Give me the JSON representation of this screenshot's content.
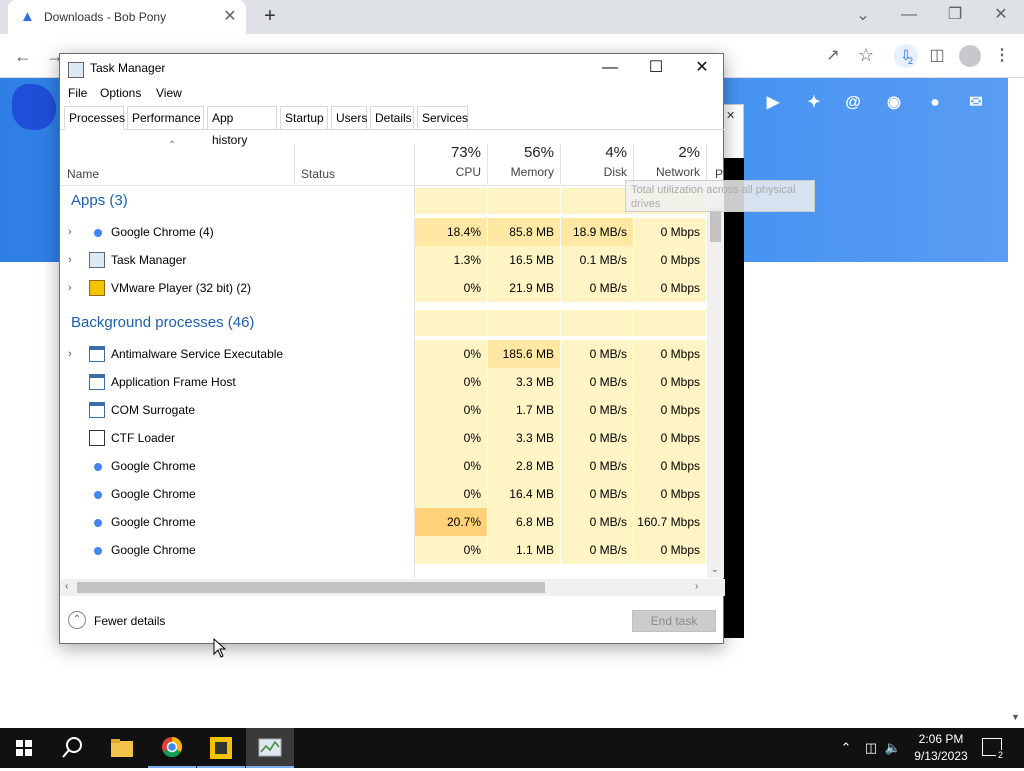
{
  "browser": {
    "tab_title": "Downloads - Bob Pony",
    "icons": [
      "chrome-favicon",
      "close-icon",
      "new-tab-icon",
      "back-icon",
      "forward-icon",
      "reload-icon",
      "share-icon",
      "star-icon",
      "download-icon",
      "side-panel-icon",
      "profile-icon",
      "menu-icon"
    ],
    "download_badge": "2"
  },
  "website": {
    "header_color": "#3a8aee",
    "social_icons": [
      "youtube-icon",
      "twitter-icon",
      "mastodon-icon",
      "discord-icon",
      "github-icon",
      "email-icon"
    ]
  },
  "task_manager": {
    "title": "Task Manager",
    "menu": [
      "File",
      "Options",
      "View"
    ],
    "tabs": [
      "Processes",
      "Performance",
      "App history",
      "Startup",
      "Users",
      "Details",
      "Services"
    ],
    "active_tab": "Processes",
    "columns": {
      "name": "Name",
      "status": "Status",
      "cpu": {
        "pct": "73%",
        "label": "CPU"
      },
      "memory": {
        "pct": "56%",
        "label": "Memory"
      },
      "disk": {
        "pct": "4%",
        "label": "Disk"
      },
      "network": {
        "pct": "2%",
        "label": "Network"
      },
      "power": "P"
    },
    "tooltip": "Total utilization across all physical drives",
    "groups": {
      "apps": "Apps (3)",
      "background": "Background processes (46)"
    },
    "apps": [
      {
        "name": "Google Chrome (4)",
        "icon": "chrome",
        "expandable": true,
        "cpu": "18.4%",
        "memory": "85.8 MB",
        "disk": "18.9 MB/s",
        "network": "0 Mbps"
      },
      {
        "name": "Task Manager",
        "icon": "taskmgr",
        "expandable": true,
        "cpu": "1.3%",
        "memory": "16.5 MB",
        "disk": "0.1 MB/s",
        "network": "0 Mbps"
      },
      {
        "name": "VMware Player (32 bit) (2)",
        "icon": "vmware",
        "expandable": true,
        "cpu": "0%",
        "memory": "21.9 MB",
        "disk": "0 MB/s",
        "network": "0 Mbps"
      }
    ],
    "background": [
      {
        "name": "Antimalware Service Executable",
        "icon": "window",
        "expandable": true,
        "cpu": "0%",
        "memory": "185.6 MB",
        "disk": "0 MB/s",
        "network": "0 Mbps"
      },
      {
        "name": "Application Frame Host",
        "icon": "window",
        "expandable": false,
        "cpu": "0%",
        "memory": "3.3 MB",
        "disk": "0 MB/s",
        "network": "0 Mbps"
      },
      {
        "name": "COM Surrogate",
        "icon": "window",
        "expandable": false,
        "cpu": "0%",
        "memory": "1.7 MB",
        "disk": "0 MB/s",
        "network": "0 Mbps"
      },
      {
        "name": "CTF Loader",
        "icon": "ctf",
        "expandable": false,
        "cpu": "0%",
        "memory": "3.3 MB",
        "disk": "0 MB/s",
        "network": "0 Mbps"
      },
      {
        "name": "Google Chrome",
        "icon": "chrome",
        "expandable": false,
        "cpu": "0%",
        "memory": "2.8 MB",
        "disk": "0 MB/s",
        "network": "0 Mbps"
      },
      {
        "name": "Google Chrome",
        "icon": "chrome",
        "expandable": false,
        "cpu": "0%",
        "memory": "16.4 MB",
        "disk": "0 MB/s",
        "network": "0 Mbps"
      },
      {
        "name": "Google Chrome",
        "icon": "chrome",
        "expandable": false,
        "cpu": "20.7%",
        "memory": "6.8 MB",
        "disk": "0 MB/s",
        "network": "160.7 Mbps"
      },
      {
        "name": "Google Chrome",
        "icon": "chrome",
        "expandable": false,
        "cpu": "0%",
        "memory": "1.1 MB",
        "disk": "0 MB/s",
        "network": "0 Mbps"
      }
    ],
    "fewer_details": "Fewer details",
    "end_task": "End task"
  },
  "taskbar": {
    "apps": [
      "start-icon",
      "search-icon",
      "file-explorer-icon",
      "chrome-icon",
      "vmware-icon",
      "task-manager-icon"
    ],
    "time": "2:06 PM",
    "date": "9/13/2023",
    "notification_count": "2"
  },
  "colors": {
    "heat_light": "#fff4c4",
    "heat_mid": "#ffe8a3",
    "heat_high": "#ffd27a",
    "group_title": "#1e5fa8"
  }
}
